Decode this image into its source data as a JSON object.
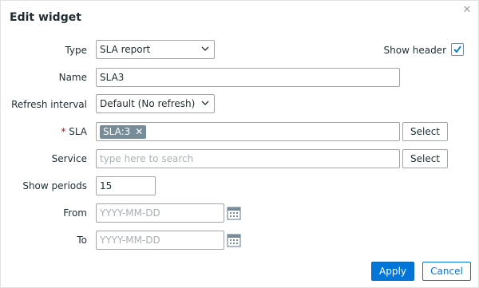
{
  "dialog": {
    "title": "Edit widget",
    "close_icon": "close-icon"
  },
  "form": {
    "type": {
      "label": "Type",
      "value": "SLA report"
    },
    "show_header": {
      "label": "Show header",
      "checked": true
    },
    "name": {
      "label": "Name",
      "value": "SLA3"
    },
    "refresh_interval": {
      "label": "Refresh interval",
      "value": "Default (No refresh)"
    },
    "sla": {
      "required_mark": "*",
      "label": "SLA",
      "tag": "SLA:3",
      "select_label": "Select"
    },
    "service": {
      "label": "Service",
      "placeholder": "type here to search",
      "select_label": "Select"
    },
    "show_periods": {
      "label": "Show periods",
      "value": "15"
    },
    "from": {
      "label": "From",
      "placeholder": "YYYY-MM-DD"
    },
    "to": {
      "label": "To",
      "placeholder": "YYYY-MM-DD"
    }
  },
  "footer": {
    "apply_label": "Apply",
    "cancel_label": "Cancel"
  },
  "colors": {
    "primary": "#0275d8",
    "tag": "#768d99",
    "required": "#d40000"
  }
}
